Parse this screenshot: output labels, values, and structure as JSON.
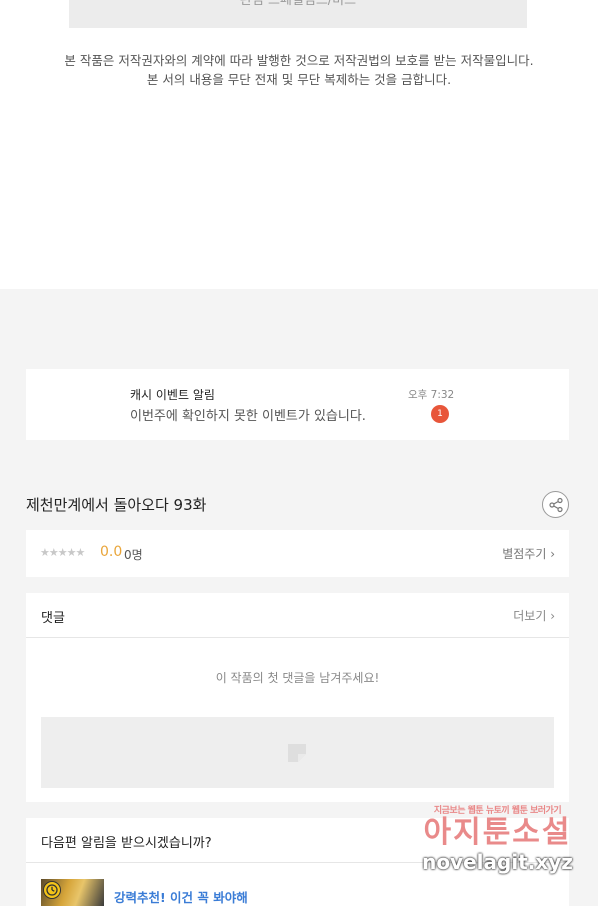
{
  "top": {
    "button_label": "관심 스페셜컴스/비스",
    "copyright_line1": "본 작품은 저작권자와의 계약에 따라 발행한 것으로 저작권법의 보호를 받는 저작물입니다.",
    "copyright_line2": "본 서의 내용을 무단 전재 및 무단 복제하는 것을 금합니다."
  },
  "notice": {
    "title": "캐시 이벤트 알림",
    "message": "이번주에 확인하지 못한 이벤트가 있습니다.",
    "time": "오후 7:32",
    "badge_count": "1"
  },
  "episode": {
    "title": "제천만계에서 돌아오다 93화",
    "share_icon": "share-icon"
  },
  "rating": {
    "stars": "★★★★★",
    "score": "0.0",
    "people": "0명",
    "rate_button": "별점주기 ›",
    "star_color": "#c8c8c8",
    "score_color": "#e9a53a"
  },
  "comments": {
    "title": "댓글",
    "more_button": "더보기 ›",
    "empty_text": "이 작품의 첫 댓글을 남겨주세요!"
  },
  "next_alarm": {
    "title": "다음편 알림을 받으시겠습니까?",
    "recommend_label": "강력추천! 이건 꼭 봐야해",
    "recommend_color": "#3a7cd6"
  },
  "watermark": {
    "line1": "지금보는 웹툰 뉴토끼 웹툰 보러가기",
    "line2": "아지툰소설",
    "line3": "novelagit.xyz"
  }
}
